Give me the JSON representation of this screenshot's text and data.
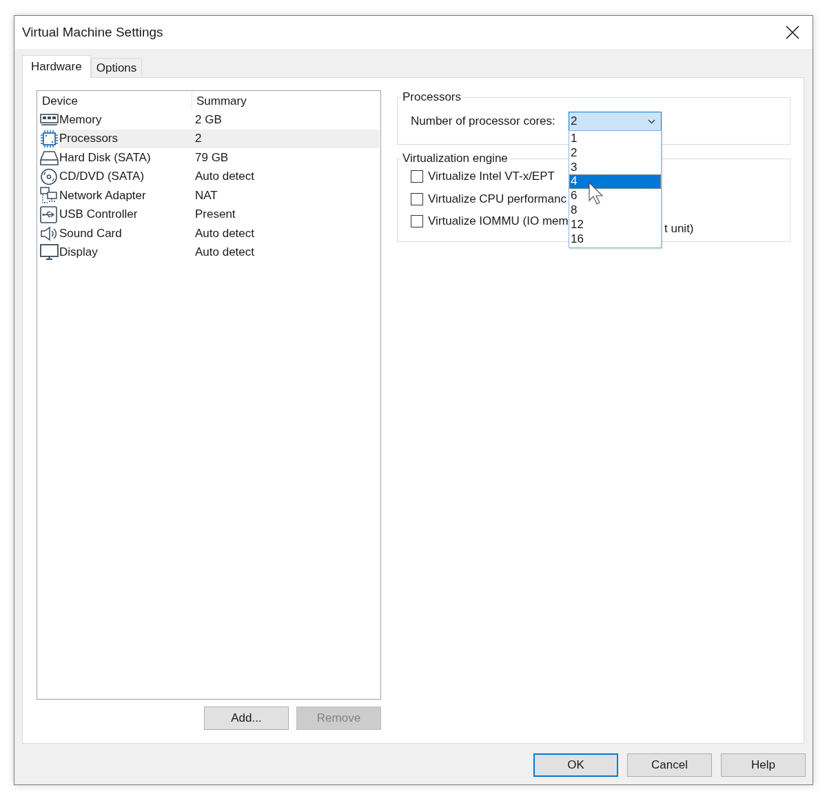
{
  "window": {
    "title": "Virtual Machine Settings"
  },
  "tabs": [
    {
      "label": "Hardware",
      "selected": true
    },
    {
      "label": "Options",
      "selected": false
    }
  ],
  "device_table": {
    "columns": [
      "Device",
      "Summary"
    ],
    "rows": [
      {
        "device": "Memory",
        "summary": "2 GB",
        "kind": "memory",
        "selected": false
      },
      {
        "device": "Processors",
        "summary": "2",
        "kind": "processor",
        "selected": true
      },
      {
        "device": "Hard Disk (SATA)",
        "summary": "79 GB",
        "kind": "disk",
        "selected": false
      },
      {
        "device": "CD/DVD (SATA)",
        "summary": "Auto detect",
        "kind": "cd",
        "selected": false
      },
      {
        "device": "Network Adapter",
        "summary": "NAT",
        "kind": "network",
        "selected": false
      },
      {
        "device": "USB Controller",
        "summary": "Present",
        "kind": "usb",
        "selected": false
      },
      {
        "device": "Sound Card",
        "summary": "Auto detect",
        "kind": "sound",
        "selected": false
      },
      {
        "device": "Display",
        "summary": "Auto detect",
        "kind": "display",
        "selected": false
      }
    ]
  },
  "list_buttons": [
    {
      "label": "Add...",
      "disabled": false
    },
    {
      "label": "Remove",
      "disabled": true
    }
  ],
  "processors": {
    "title": "Processors",
    "cores_label": "Number of processor cores:",
    "cores_value": "2",
    "dropdown": {
      "expanded": true,
      "options": [
        {
          "label": "1",
          "selected": false
        },
        {
          "label": "2",
          "selected": false
        },
        {
          "label": "3",
          "selected": false
        },
        {
          "label": "4",
          "selected": true
        },
        {
          "label": "6",
          "selected": false
        },
        {
          "label": "8",
          "selected": false
        },
        {
          "label": "12",
          "selected": false
        },
        {
          "label": "16",
          "selected": false
        }
      ]
    }
  },
  "virtualization": {
    "title": "Virtualization engine",
    "options": [
      {
        "label": "Virtualize Intel VT-x/EPT",
        "checked": false
      },
      {
        "label": "Virtualize CPU performanc",
        "checked": false
      },
      {
        "label": "Virtualize IOMMU (IO mem",
        "tail": "t unit)",
        "checked": false
      }
    ]
  },
  "buttons": [
    {
      "label": "OK",
      "default": true
    },
    {
      "label": "Cancel",
      "default": false
    },
    {
      "label": "Help",
      "default": false
    }
  ]
}
